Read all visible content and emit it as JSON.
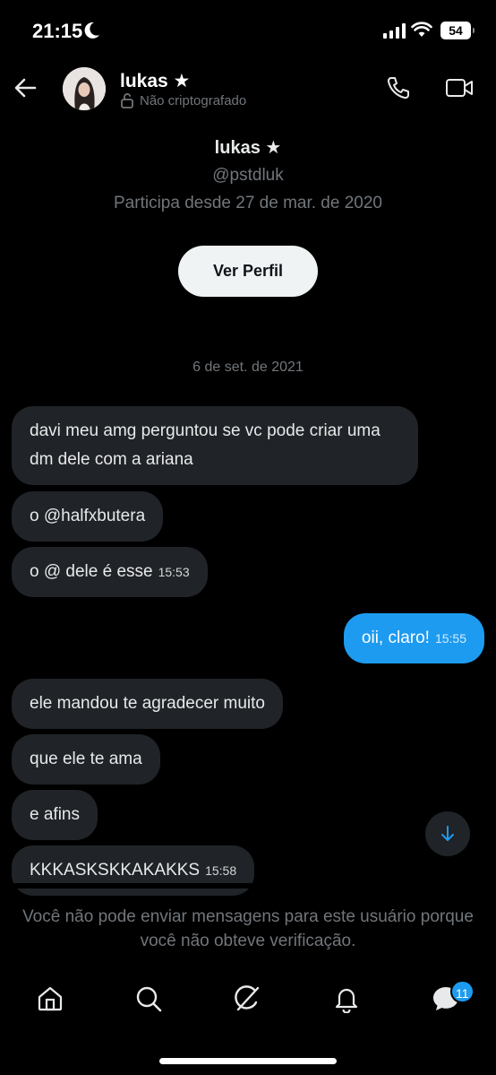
{
  "status": {
    "time": "21:15",
    "battery": "54"
  },
  "header": {
    "name": "lukas ★",
    "encryption": "Não criptografado"
  },
  "profile": {
    "name": "lukas ★",
    "handle": "@pstdluk",
    "joined": "Participa desde 27 de mar. de 2020",
    "view_profile_label": "Ver Perfil"
  },
  "date_separator": "6 de set. de 2021",
  "messages": [
    {
      "text": "davi meu amg perguntou se vc pode criar uma dm dele com a ariana",
      "time": "",
      "direction": "in"
    },
    {
      "text": "o @halfxbutera",
      "time": "",
      "direction": "in"
    },
    {
      "text": "o @ dele é esse",
      "time": "15:53",
      "direction": "in"
    },
    {
      "text": "oii, claro!",
      "time": "15:55",
      "direction": "out"
    },
    {
      "text": "ele mandou te agradecer muito",
      "time": "",
      "direction": "in"
    },
    {
      "text": "que ele te ama",
      "time": "",
      "direction": "in"
    },
    {
      "text": "e afins",
      "time": "",
      "direction": "in"
    },
    {
      "text": "KKKASKSKKAKAKKS",
      "time": "15:58",
      "direction": "in"
    }
  ],
  "notice": "Você não pode enviar mensagens para este usuário porque você não obteve verificação.",
  "tabs": [
    {
      "icon": "home-icon"
    },
    {
      "icon": "search-icon"
    },
    {
      "icon": "grok-icon"
    },
    {
      "icon": "bell-icon"
    },
    {
      "icon": "messages-icon"
    }
  ],
  "messages_badge": "11",
  "colors": {
    "accent": "#1d9bf0",
    "bubble": "#202327",
    "muted": "#71767b"
  }
}
